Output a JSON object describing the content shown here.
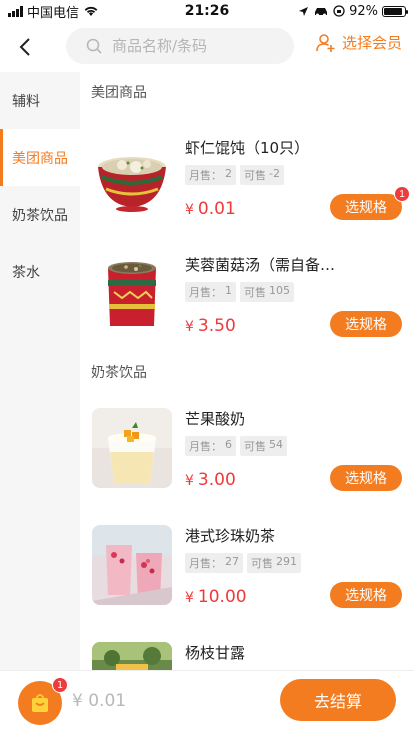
{
  "status_bar": {
    "carrier": "中国电信",
    "time": "21:26",
    "battery": "92%",
    "battery_level": 0.92
  },
  "header": {
    "back_icon": "chevron-left-icon",
    "search_placeholder": "商品名称/条码",
    "member_label": "选择会员"
  },
  "colors": {
    "accent": "#f47c20",
    "price": "#ee3a3a",
    "badge": "#ee3b3b"
  },
  "sidebar": {
    "items": [
      {
        "label": "辅料"
      },
      {
        "label": "美团商品",
        "active": true
      },
      {
        "label": "奶茶饮品"
      },
      {
        "label": "茶水"
      }
    ]
  },
  "sections": [
    {
      "title": "美团商品",
      "products": [
        {
          "name": "虾仁馄饨（10只）",
          "sold_label": "月售：",
          "sold": "2",
          "stock_label": "可售",
          "stock": "-2",
          "currency": "¥",
          "price": "0.01",
          "button": "选规格",
          "badge": "1"
        },
        {
          "name": "芙蓉菌菇汤（需自备…",
          "sold_label": "月售：",
          "sold": "1",
          "stock_label": "可售",
          "stock": "105",
          "currency": "¥",
          "price": "3.50",
          "button": "选规格"
        }
      ]
    },
    {
      "title": "奶茶饮品",
      "products": [
        {
          "name": "芒果酸奶",
          "sold_label": "月售：",
          "sold": "6",
          "stock_label": "可售",
          "stock": "54",
          "currency": "¥",
          "price": "3.00",
          "button": "选规格"
        },
        {
          "name": "港式珍珠奶茶",
          "sold_label": "月售：",
          "sold": "27",
          "stock_label": "可售",
          "stock": "291",
          "currency": "¥",
          "price": "10.00",
          "button": "选规格"
        },
        {
          "name": "杨枝甘露"
        }
      ]
    }
  ],
  "bottom_bar": {
    "cart_badge": "1",
    "total": "¥ 0.01",
    "checkout_label": "去结算"
  }
}
